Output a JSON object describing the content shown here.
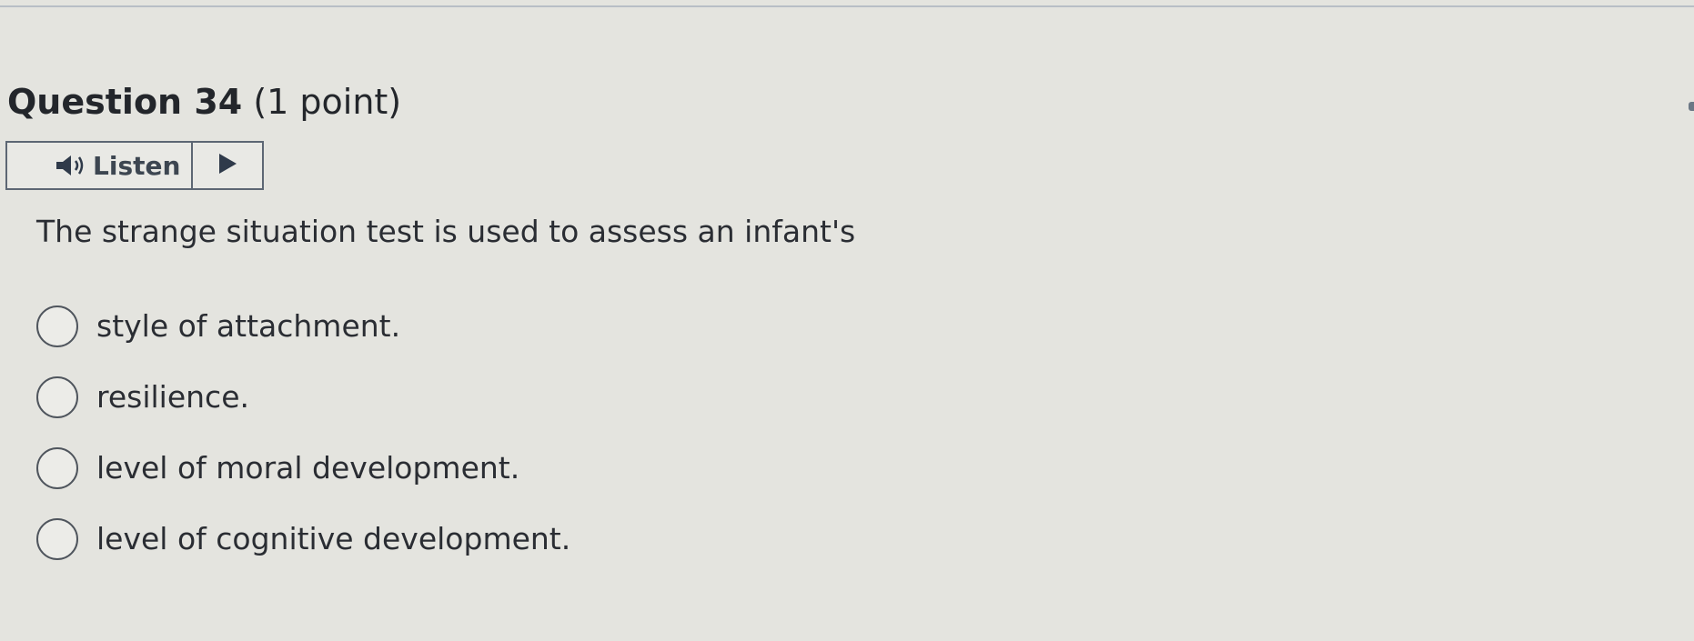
{
  "question": {
    "title": "Question 34",
    "points": "(1 point)",
    "text": "The strange situation test is used to assess an infant's"
  },
  "listen_widget": {
    "label": "Listen",
    "speaker_icon": "speaker-icon",
    "play_icon": "play-icon"
  },
  "options": [
    {
      "label": "style of attachment.",
      "selected": false
    },
    {
      "label": "resilience.",
      "selected": false
    },
    {
      "label": "level of moral development.",
      "selected": false
    },
    {
      "label": "level of cognitive development.",
      "selected": false
    }
  ]
}
